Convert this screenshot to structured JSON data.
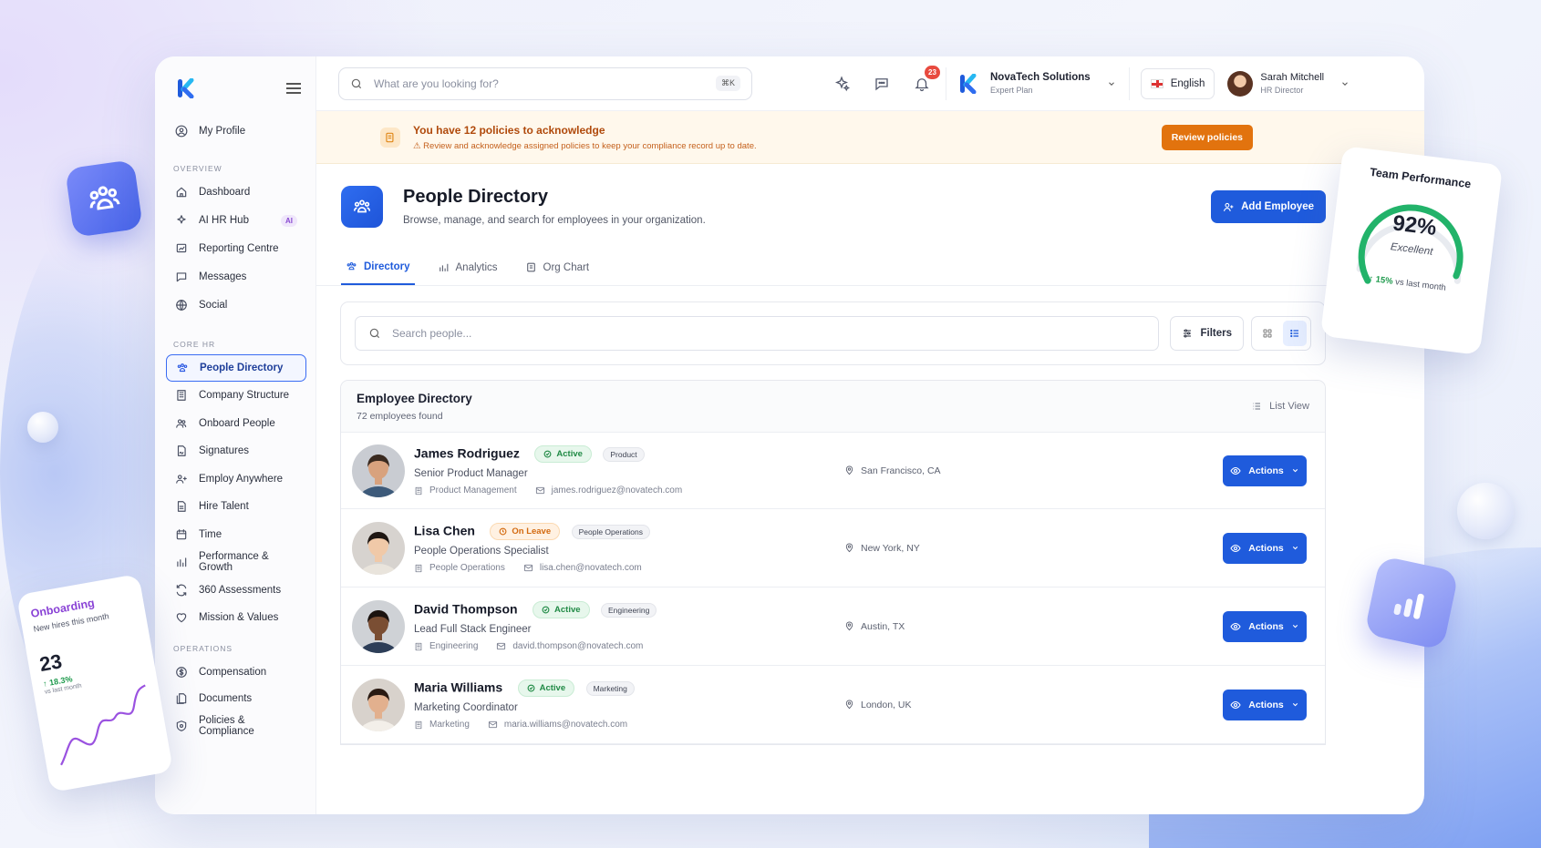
{
  "search": {
    "placeholder": "What are you looking for?",
    "shortcut": "⌘K"
  },
  "topbar": {
    "notifications_count": "23",
    "company_name": "NovaTech Solutions",
    "company_plan": "Expert Plan",
    "language": "English",
    "user_name": "Sarah Mitchell",
    "user_role": "HR Director"
  },
  "banner": {
    "title": "You have 12 policies to acknowledge",
    "subtitle": "Review and acknowledge assigned policies to keep your compliance record up to date.",
    "button": "Review policies"
  },
  "sidebar": {
    "profile": "My Profile",
    "sections": [
      {
        "label": "OVERVIEW",
        "items": [
          {
            "label": "Dashboard",
            "icon": "home-icon"
          },
          {
            "label": "AI HR Hub",
            "icon": "sparkles-icon",
            "badge": "AI"
          },
          {
            "label": "Reporting Centre",
            "icon": "report-icon"
          },
          {
            "label": "Messages",
            "icon": "chat-icon"
          },
          {
            "label": "Social",
            "icon": "globe-icon"
          }
        ]
      },
      {
        "label": "CORE HR",
        "items": [
          {
            "label": "People Directory",
            "icon": "people-icon",
            "active": true
          },
          {
            "label": "Company Structure",
            "icon": "building-icon"
          },
          {
            "label": "Onboard People",
            "icon": "users-plus-icon"
          },
          {
            "label": "Signatures",
            "icon": "document-sign-icon"
          },
          {
            "label": "Employ Anywhere",
            "icon": "users-icon"
          },
          {
            "label": "Hire Talent",
            "icon": "file-icon"
          },
          {
            "label": "Time",
            "icon": "calendar-icon"
          },
          {
            "label": "Performance & Growth",
            "icon": "bar-chart-icon"
          },
          {
            "label": "360 Assessments",
            "icon": "refresh-icon"
          },
          {
            "label": "Mission & Values",
            "icon": "heart-icon"
          }
        ]
      },
      {
        "label": "OPERATIONS",
        "items": [
          {
            "label": "Compensation",
            "icon": "dollar-icon"
          },
          {
            "label": "Documents",
            "icon": "documents-icon"
          },
          {
            "label": "Policies & Compliance",
            "icon": "shield-icon"
          }
        ]
      }
    ]
  },
  "page": {
    "title": "People Directory",
    "subtitle": "Browse, manage, and search for employees in your organization.",
    "add_button": "Add Employee",
    "tabs": [
      "Directory",
      "Analytics",
      "Org Chart"
    ]
  },
  "filters": {
    "search_placeholder": "Search people...",
    "filters_label": "Filters"
  },
  "directory": {
    "title": "Employee Directory",
    "count": "72 employees found",
    "view_label": "List View",
    "actions_label": "Actions",
    "employees": [
      {
        "name": "James Rodriguez",
        "status": "Active",
        "status_type": "active",
        "dept_tag": "Product",
        "title": "Senior Product Manager",
        "department": "Product Management",
        "email": "james.rodriguez@novatech.com",
        "location": "San Francisco, CA"
      },
      {
        "name": "Lisa Chen",
        "status": "On Leave",
        "status_type": "leave",
        "dept_tag": "People Operations",
        "title": "People Operations Specialist",
        "department": "People Operations",
        "email": "lisa.chen@novatech.com",
        "location": "New York, NY"
      },
      {
        "name": "David Thompson",
        "status": "Active",
        "status_type": "active",
        "dept_tag": "Engineering",
        "title": "Lead Full Stack Engineer",
        "department": "Engineering",
        "email": "david.thompson@novatech.com",
        "location": "Austin, TX"
      },
      {
        "name": "Maria Williams",
        "status": "Active",
        "status_type": "active",
        "dept_tag": "Marketing",
        "title": "Marketing Coordinator",
        "department": "Marketing",
        "email": "maria.williams@novatech.com",
        "location": "London, UK"
      }
    ]
  },
  "widgets": {
    "team_performance": {
      "title": "Team Performance",
      "value": "92%",
      "percent": 92,
      "label": "Excellent",
      "trend": "15%",
      "trend_suffix": "vs last month"
    },
    "onboarding": {
      "title": "Onboarding",
      "subtitle": "New hires this month",
      "value": "23",
      "trend": "18.3%",
      "trend_suffix": "vs last month"
    }
  },
  "colors": {
    "primary": "#1f5bdc",
    "warning": "#e2730e",
    "success": "#1f9a4d"
  }
}
